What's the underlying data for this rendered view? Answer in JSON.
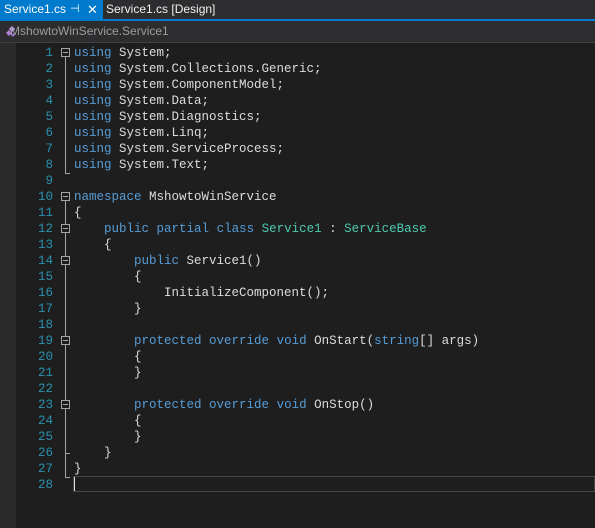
{
  "tabs": [
    {
      "label": "Service1.cs",
      "active": true,
      "pin_icon": "pin-icon",
      "close_icon": "close-icon"
    },
    {
      "label": "Service1.cs [Design]",
      "active": false
    }
  ],
  "navbar": {
    "icon": "class-icon",
    "label": "MshowtoWinService.Service1"
  },
  "editor": {
    "lines": [
      {
        "n": "1",
        "parts": [
          {
            "t": "using",
            "c": "kw"
          },
          {
            "t": " System;"
          }
        ]
      },
      {
        "n": "2",
        "parts": [
          {
            "t": "using",
            "c": "kw"
          },
          {
            "t": " System.Collections.Generic;"
          }
        ]
      },
      {
        "n": "3",
        "parts": [
          {
            "t": "using",
            "c": "kw"
          },
          {
            "t": " System.ComponentModel;"
          }
        ]
      },
      {
        "n": "4",
        "parts": [
          {
            "t": "using",
            "c": "kw"
          },
          {
            "t": " System.Data;"
          }
        ]
      },
      {
        "n": "5",
        "parts": [
          {
            "t": "using",
            "c": "kw"
          },
          {
            "t": " System.Diagnostics;"
          }
        ]
      },
      {
        "n": "6",
        "parts": [
          {
            "t": "using",
            "c": "kw"
          },
          {
            "t": " System.Linq;"
          }
        ]
      },
      {
        "n": "7",
        "parts": [
          {
            "t": "using",
            "c": "kw"
          },
          {
            "t": " System.ServiceProcess;"
          }
        ]
      },
      {
        "n": "8",
        "parts": [
          {
            "t": "using",
            "c": "kw"
          },
          {
            "t": " System.Text;"
          }
        ]
      },
      {
        "n": "9",
        "parts": []
      },
      {
        "n": "10",
        "parts": [
          {
            "t": "namespace",
            "c": "kw"
          },
          {
            "t": " MshowtoWinService"
          }
        ]
      },
      {
        "n": "11",
        "parts": [
          {
            "t": "{"
          }
        ]
      },
      {
        "n": "12",
        "parts": [
          {
            "t": "    "
          },
          {
            "t": "public",
            "c": "kw"
          },
          {
            "t": " "
          },
          {
            "t": "partial",
            "c": "kw"
          },
          {
            "t": " "
          },
          {
            "t": "class",
            "c": "kw"
          },
          {
            "t": " "
          },
          {
            "t": "Service1",
            "c": "ty"
          },
          {
            "t": " : "
          },
          {
            "t": "ServiceBase",
            "c": "ty"
          }
        ]
      },
      {
        "n": "13",
        "parts": [
          {
            "t": "    {"
          }
        ]
      },
      {
        "n": "14",
        "parts": [
          {
            "t": "        "
          },
          {
            "t": "public",
            "c": "kw"
          },
          {
            "t": " Service1()"
          }
        ]
      },
      {
        "n": "15",
        "parts": [
          {
            "t": "        {"
          }
        ]
      },
      {
        "n": "16",
        "parts": [
          {
            "t": "            InitializeComponent();"
          }
        ]
      },
      {
        "n": "17",
        "parts": [
          {
            "t": "        }"
          }
        ]
      },
      {
        "n": "18",
        "parts": []
      },
      {
        "n": "19",
        "parts": [
          {
            "t": "        "
          },
          {
            "t": "protected",
            "c": "kw"
          },
          {
            "t": " "
          },
          {
            "t": "override",
            "c": "kw"
          },
          {
            "t": " "
          },
          {
            "t": "void",
            "c": "kw"
          },
          {
            "t": " OnStart("
          },
          {
            "t": "string",
            "c": "kw"
          },
          {
            "t": "[] args)"
          }
        ]
      },
      {
        "n": "20",
        "parts": [
          {
            "t": "        {"
          }
        ]
      },
      {
        "n": "21",
        "parts": [
          {
            "t": "        }"
          }
        ]
      },
      {
        "n": "22",
        "parts": []
      },
      {
        "n": "23",
        "parts": [
          {
            "t": "        "
          },
          {
            "t": "protected",
            "c": "kw"
          },
          {
            "t": " "
          },
          {
            "t": "override",
            "c": "kw"
          },
          {
            "t": " "
          },
          {
            "t": "void",
            "c": "kw"
          },
          {
            "t": " OnStop()"
          }
        ]
      },
      {
        "n": "24",
        "parts": [
          {
            "t": "        {"
          }
        ]
      },
      {
        "n": "25",
        "parts": [
          {
            "t": "        }"
          }
        ]
      },
      {
        "n": "26",
        "parts": [
          {
            "t": "    }"
          }
        ]
      },
      {
        "n": "27",
        "parts": [
          {
            "t": "}"
          }
        ]
      },
      {
        "n": "28",
        "parts": []
      }
    ],
    "colors": {
      "keyword": "#569cd6",
      "type": "#4ec9b0",
      "text": "#dcdcdc",
      "line_number": "#2b91af",
      "background": "#1e1e1e",
      "accent": "#007acc"
    }
  }
}
